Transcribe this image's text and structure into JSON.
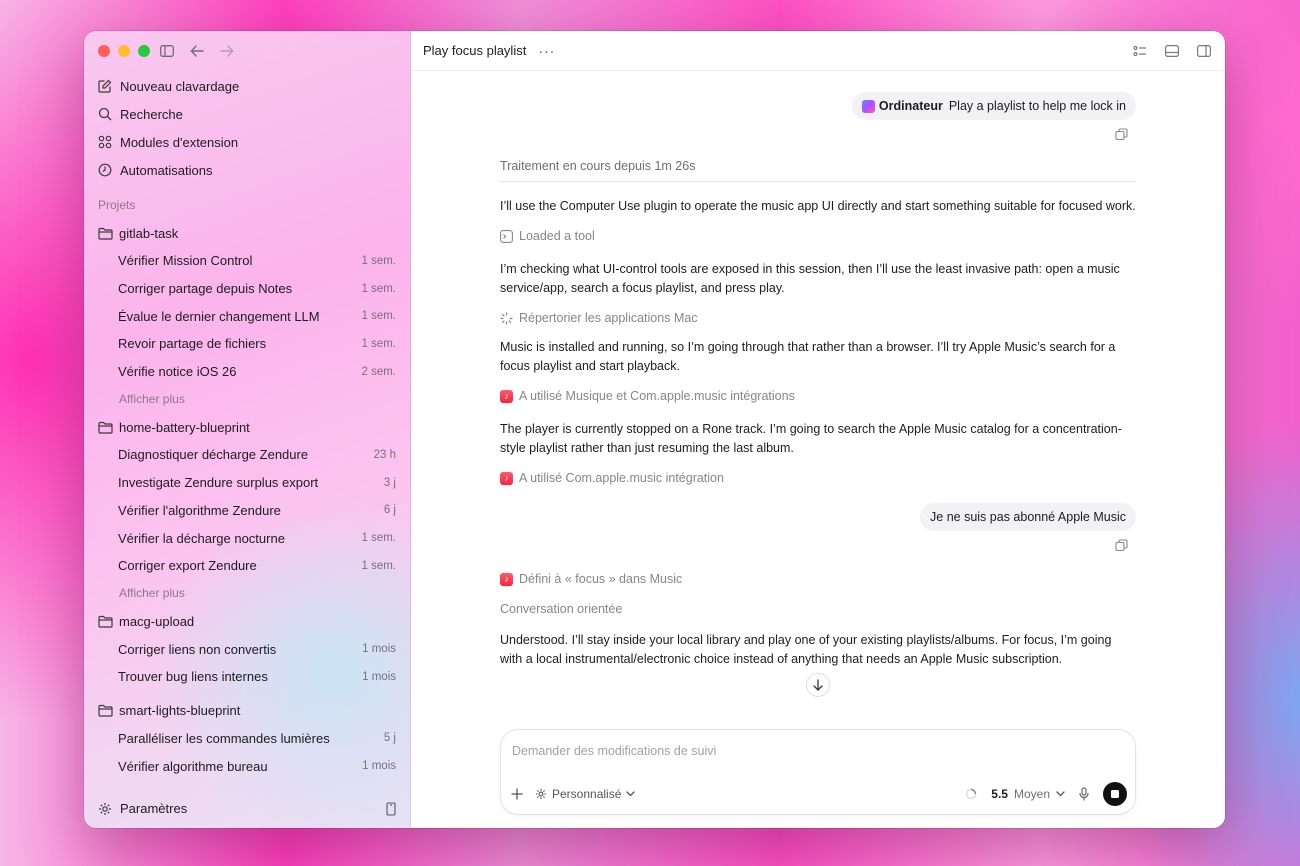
{
  "window": {
    "title": "Play focus playlist"
  },
  "sidebar": {
    "nav": [
      {
        "label": "Nouveau clavardage",
        "icon": "compose-icon"
      },
      {
        "label": "Recherche",
        "icon": "search-icon"
      },
      {
        "label": "Modules d'extension",
        "icon": "grid-icon"
      },
      {
        "label": "Automatisations",
        "icon": "clock-icon"
      }
    ],
    "projects_label": "Projets",
    "projects": [
      {
        "name": "gitlab-task",
        "threads": [
          {
            "title": "Vérifier Mission Control",
            "age": "1 sem."
          },
          {
            "title": "Corriger partage depuis Notes",
            "age": "1 sem."
          },
          {
            "title": "Évalue le dernier changement LLM",
            "age": "1 sem."
          },
          {
            "title": "Revoir partage de fichiers",
            "age": "1 sem."
          },
          {
            "title": "Vérifie notice iOS 26",
            "age": "2 sem."
          }
        ],
        "more": "Afficher plus"
      },
      {
        "name": "home-battery-blueprint",
        "threads": [
          {
            "title": "Diagnostiquer décharge Zendure",
            "age": "23 h"
          },
          {
            "title": "Investigate Zendure surplus export",
            "age": "3 j"
          },
          {
            "title": "Vérifier l'algorithme Zendure",
            "age": "6 j"
          },
          {
            "title": "Vérifier la décharge nocturne",
            "age": "1 sem."
          },
          {
            "title": "Corriger export Zendure",
            "age": "1 sem."
          }
        ],
        "more": "Afficher plus"
      },
      {
        "name": "macg-upload",
        "threads": [
          {
            "title": "Corriger liens non convertis",
            "age": "1 mois"
          },
          {
            "title": "Trouver bug liens internes",
            "age": "1 mois"
          }
        ]
      },
      {
        "name": "smart-lights-blueprint",
        "threads": [
          {
            "title": "Paralléliser les commandes lumières",
            "age": "5 j"
          },
          {
            "title": "Vérifier algorithme bureau",
            "age": "1 mois"
          }
        ]
      }
    ],
    "settings_label": "Paramètres"
  },
  "conversation": {
    "user1": {
      "app": "Ordinateur",
      "text": "Play a playlist to help me lock in"
    },
    "status": "Traitement en cours depuis 1m 26s",
    "p1": "I’ll use the Computer Use plugin to operate the music app UI directly and start something suitable for focused work.",
    "tool1": "Loaded a tool",
    "p2": "I’m checking what UI-control tools are exposed in this session, then I’ll use the least invasive path: open a music service/app, search a focus playlist, and press play.",
    "tool2": "Répertorier les applications Mac",
    "p3": "Music is installed and running, so I’m going through that rather than a browser. I’ll try Apple Music’s search for a focus playlist and start playback.",
    "tool3": "A utilisé Musique et Com.apple.music intégrations",
    "p4": "The player is currently stopped on a Rone track. I’m going to search the Apple Music catalog for a concentration-style playlist rather than just resuming the last album.",
    "tool4": "A utilisé Com.apple.music intégration",
    "user2": "Je ne suis pas abonné Apple Music",
    "tool5": "Défini à « focus » dans Music",
    "note": "Conversation orientée",
    "p5": "Understood. I’ll stay inside your local library and play one of your existing playlists/albums. For focus, I’m going with a local instrumental/electronic choice instead of anything that needs an Apple Music subscription."
  },
  "composer": {
    "placeholder": "Demander des modifications de suivi",
    "mode": "Personnalisé",
    "model_version": "5.5",
    "effort": "Moyen"
  }
}
